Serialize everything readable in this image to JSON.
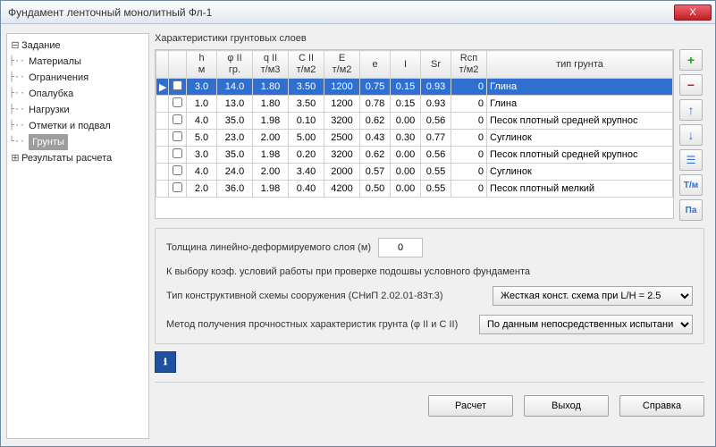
{
  "window": {
    "title": "Фундамент ленточный монолитный Фл-1"
  },
  "close": "X",
  "tree": {
    "root": "Задание",
    "items": [
      "Материалы",
      "Ограничения",
      "Опалубка",
      "Нагрузки",
      "Отметки и подвал",
      "Грунты"
    ],
    "selected": 5,
    "results": "Результаты расчета"
  },
  "table": {
    "caption": "Характеристики грунтовых слоев",
    "headers": [
      "h\nм",
      "φ II\nгр.",
      "q II\nт/м3",
      "C II\nт/м2",
      "E\nт/м2",
      "e",
      "I",
      "Sr",
      "Rcп\nт/м2",
      "тип грунта"
    ],
    "rows": [
      {
        "sel": true,
        "check": false,
        "h": "3.0",
        "phi": "14.0",
        "q": "1.80",
        "c": "3.50",
        "E": "1200",
        "e": "0.75",
        "I": "0.15",
        "Sr": "0.93",
        "Rcn": "0",
        "type": "Глина"
      },
      {
        "sel": false,
        "check": false,
        "h": "1.0",
        "phi": "13.0",
        "q": "1.80",
        "c": "3.50",
        "E": "1200",
        "e": "0.78",
        "I": "0.15",
        "Sr": "0.93",
        "Rcn": "0",
        "type": "Глина"
      },
      {
        "sel": false,
        "check": false,
        "h": "4.0",
        "phi": "35.0",
        "q": "1.98",
        "c": "0.10",
        "E": "3200",
        "e": "0.62",
        "I": "0.00",
        "Sr": "0.56",
        "Rcn": "0",
        "type": "Песок плотный средней крупнос"
      },
      {
        "sel": false,
        "check": false,
        "h": "5.0",
        "phi": "23.0",
        "q": "2.00",
        "c": "5.00",
        "E": "2500",
        "e": "0.43",
        "I": "0.30",
        "Sr": "0.77",
        "Rcn": "0",
        "type": "Суглинок"
      },
      {
        "sel": false,
        "check": false,
        "h": "3.0",
        "phi": "35.0",
        "q": "1.98",
        "c": "0.20",
        "E": "3200",
        "e": "0.62",
        "I": "0.00",
        "Sr": "0.56",
        "Rcn": "0",
        "type": "Песок плотный средней крупнос"
      },
      {
        "sel": false,
        "check": false,
        "h": "4.0",
        "phi": "24.0",
        "q": "2.00",
        "c": "3.40",
        "E": "2000",
        "e": "0.57",
        "I": "0.00",
        "Sr": "0.55",
        "Rcn": "0",
        "type": "Суглинок"
      },
      {
        "sel": false,
        "check": false,
        "h": "2.0",
        "phi": "36.0",
        "q": "1.98",
        "c": "0.40",
        "E": "4200",
        "e": "0.50",
        "I": "0.00",
        "Sr": "0.55",
        "Rcn": "0",
        "type": "Песок плотный мелкий"
      }
    ]
  },
  "tools": {
    "add": "+",
    "del": "−",
    "up": "↑",
    "down": "↓",
    "props": "☰",
    "tm": "T/м",
    "pa": "Па"
  },
  "form": {
    "thick_label": "Толщина линейно-деформируемого слоя (м)",
    "thick_value": "0",
    "note": "К выбору коэф. условий работы при проверке подошвы условного фундамента",
    "scheme_label": "Тип конструктивной схемы сооружения (СНиП 2.02.01-83т.3)",
    "scheme_value": "Жесткая конст. схема при L/H  = 2.5",
    "method_label": "Метод получения прочностных характеристик грунта  (φ II и C II)",
    "method_value": "По данным непосредственных испытани"
  },
  "buttons": {
    "calc": "Расчет",
    "exit": "Выход",
    "help": "Справка"
  }
}
